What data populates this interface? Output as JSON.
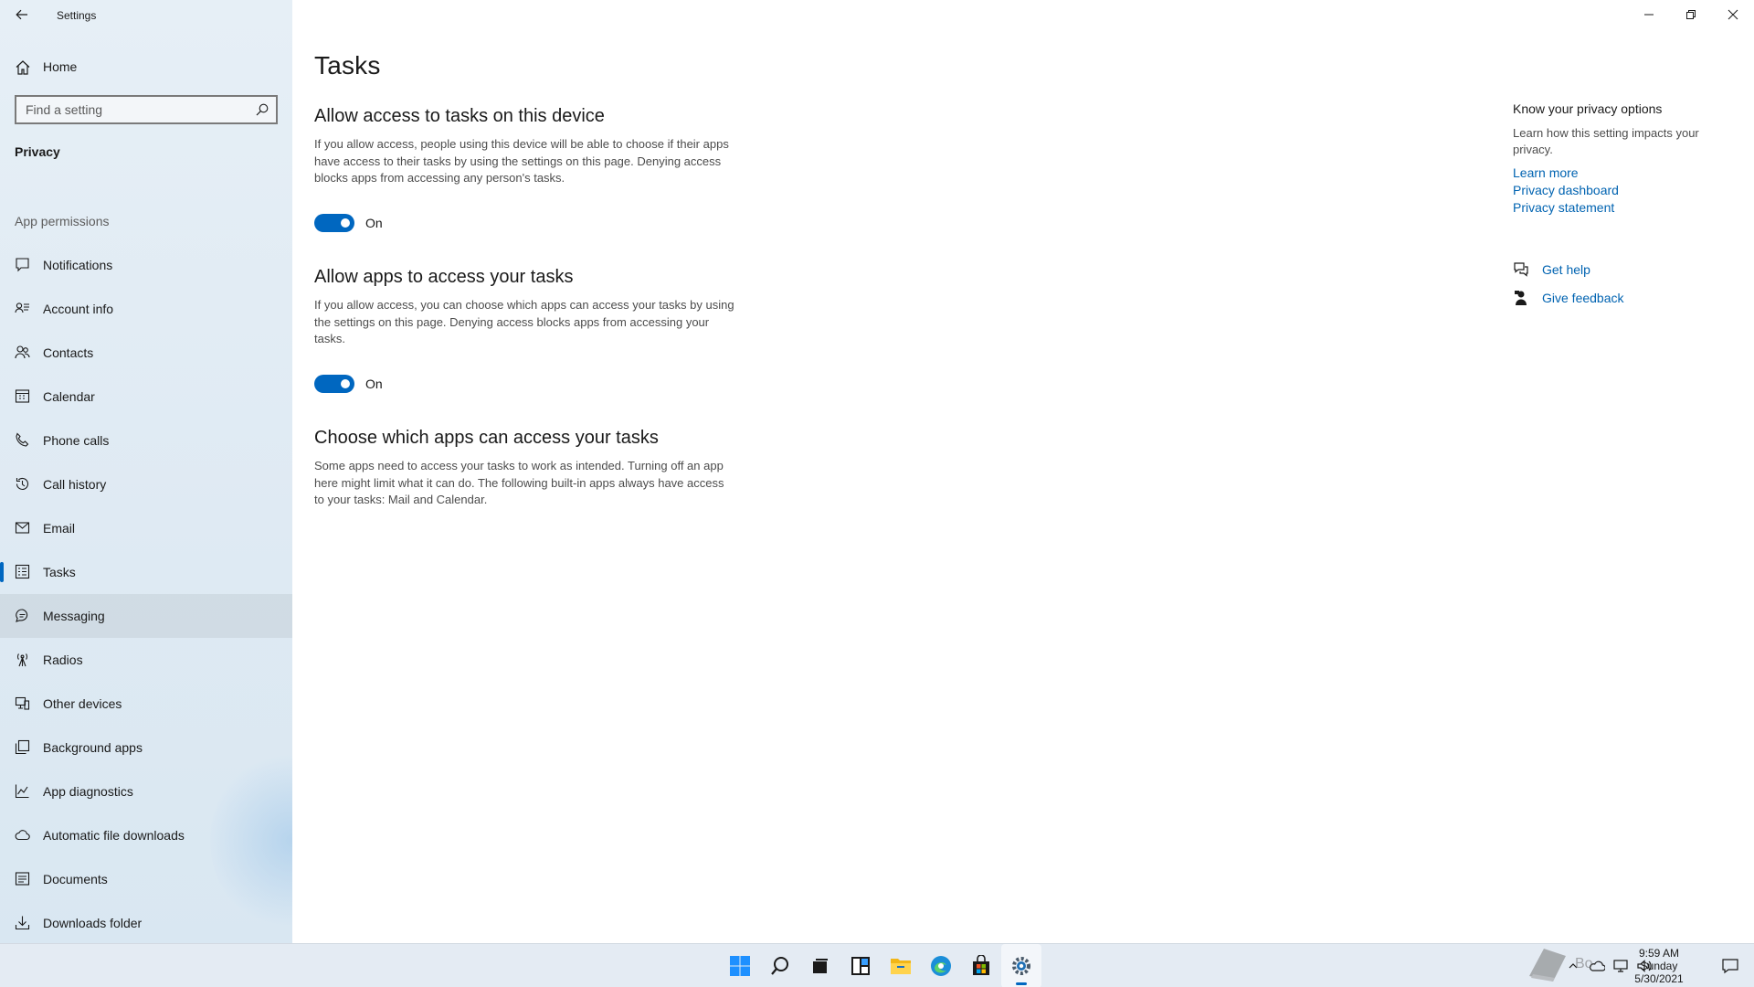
{
  "window": {
    "title": "Settings",
    "controls": [
      "minimize",
      "restore",
      "close"
    ]
  },
  "sidebar": {
    "home_label": "Home",
    "search": {
      "placeholder": "Find a setting"
    },
    "section_title": "Privacy",
    "group_label": "App permissions",
    "items": [
      {
        "label": "Notifications",
        "icon": "notification-icon"
      },
      {
        "label": "Account info",
        "icon": "account-info-icon"
      },
      {
        "label": "Contacts",
        "icon": "contacts-icon"
      },
      {
        "label": "Calendar",
        "icon": "calendar-icon"
      },
      {
        "label": "Phone calls",
        "icon": "phone-icon"
      },
      {
        "label": "Call history",
        "icon": "history-icon"
      },
      {
        "label": "Email",
        "icon": "mail-icon"
      },
      {
        "label": "Tasks",
        "icon": "tasks-icon",
        "selected": true
      },
      {
        "label": "Messaging",
        "icon": "message-icon",
        "hovered": true
      },
      {
        "label": "Radios",
        "icon": "radio-tower-icon"
      },
      {
        "label": "Other devices",
        "icon": "devices-icon"
      },
      {
        "label": "Background apps",
        "icon": "background-apps-icon"
      },
      {
        "label": "App diagnostics",
        "icon": "diagnostics-icon"
      },
      {
        "label": "Automatic file downloads",
        "icon": "cloud-icon"
      },
      {
        "label": "Documents",
        "icon": "document-icon"
      },
      {
        "label": "Downloads folder",
        "icon": "download-icon"
      }
    ]
  },
  "main": {
    "page_title": "Tasks",
    "sections": [
      {
        "heading": "Allow access to tasks on this device",
        "description": "If you allow access, people using this device will be able to choose if their apps have access to their tasks by using the settings on this page. Denying access blocks apps from accessing any person's tasks.",
        "toggle": {
          "state": "on",
          "label": "On"
        }
      },
      {
        "heading": "Allow apps to access your tasks",
        "description": "If you allow access, you can choose which apps can access your tasks by using the settings on this page. Denying access blocks apps from accessing your tasks.",
        "toggle": {
          "state": "on",
          "label": "On"
        }
      },
      {
        "heading": "Choose which apps can access your tasks",
        "description": "Some apps need to access your tasks to work as intended. Turning off an app here might limit what it can do. The following built-in apps always have access to your tasks: Mail and Calendar."
      }
    ]
  },
  "right_panel": {
    "title": "Know your privacy options",
    "description": "Learn how this setting impacts your privacy.",
    "links": [
      "Learn more",
      "Privacy dashboard",
      "Privacy statement"
    ],
    "help": {
      "label": "Get help",
      "icon": "get-help-icon"
    },
    "feedback": {
      "label": "Give feedback",
      "icon": "feedback-icon"
    }
  },
  "taskbar": {
    "apps": [
      {
        "name": "start-icon"
      },
      {
        "name": "search-icon"
      },
      {
        "name": "task-view-icon"
      },
      {
        "name": "widgets-icon"
      },
      {
        "name": "file-explorer-icon"
      },
      {
        "name": "edge-icon"
      },
      {
        "name": "store-icon"
      },
      {
        "name": "settings-icon",
        "active": true
      }
    ],
    "clock": {
      "time": "9:59 AM",
      "day": "Sunday",
      "date": "5/30/2021"
    },
    "watermark": "Bo"
  },
  "colors": {
    "accent": "#0067c0",
    "link": "#0063b1",
    "sidebar_bg": "#e6eff6",
    "taskbar_bg": "#e4ebf3"
  }
}
